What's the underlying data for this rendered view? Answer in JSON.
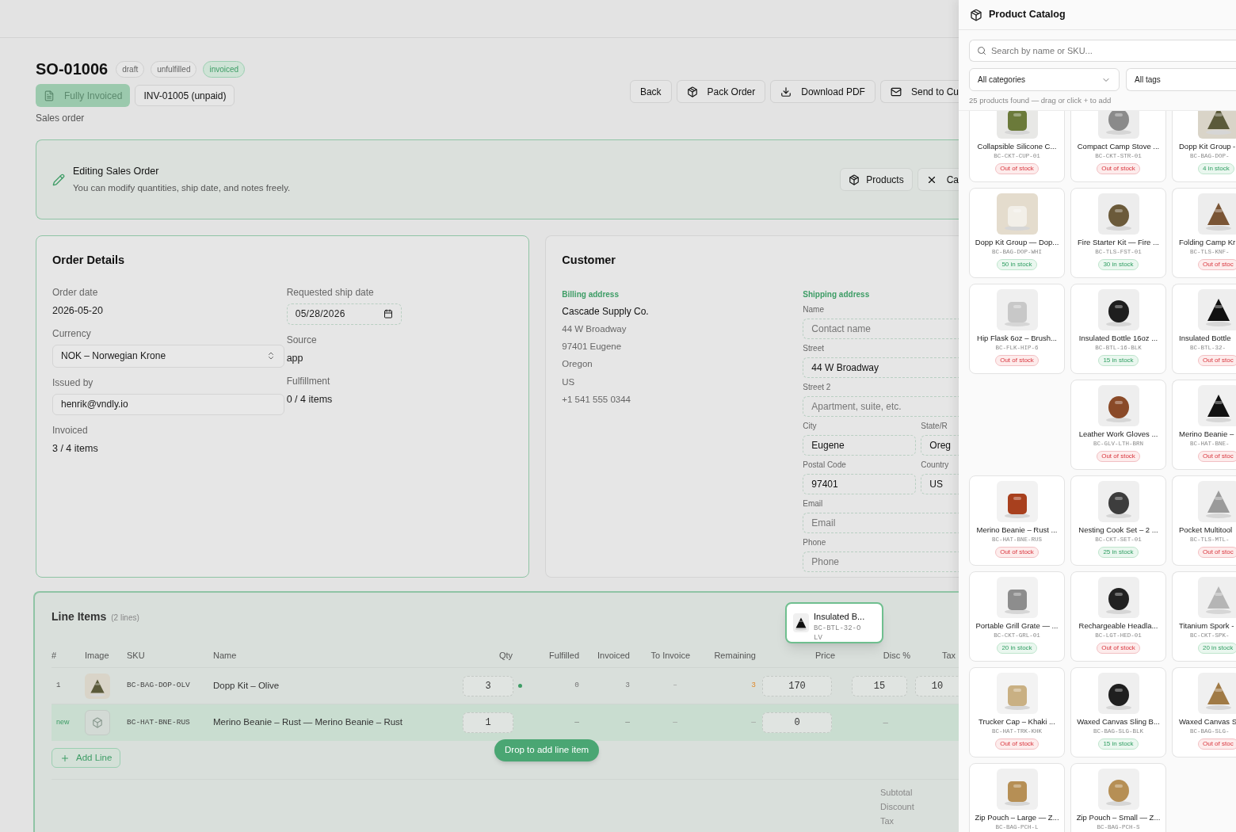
{
  "order": {
    "number": "SO-01006",
    "badges": [
      {
        "label": "draft",
        "selected": false
      },
      {
        "label": "unfulfilled",
        "selected": false
      },
      {
        "label": "invoiced",
        "selected": true
      }
    ],
    "status_button": {
      "label": "Fully Invoiced",
      "disabled": true
    },
    "invoice_button": "INV-01005 (unpaid)",
    "subtitle": "Sales order",
    "actions": [
      "Back",
      "Pack Order",
      "Download PDF",
      "Send to Cu"
    ]
  },
  "banner": {
    "title": "Editing Sales Order",
    "text": "You can modify quantities, ship date, and notes freely.",
    "buttons": [
      "Products",
      "Ca"
    ]
  },
  "order_details": {
    "title": "Order Details",
    "left": [
      {
        "label": "Order date",
        "value": "2026-05-20",
        "kind": "text"
      },
      {
        "label": "Currency",
        "value": "NOK – Norwegian Krone",
        "kind": "select"
      },
      {
        "label": "Issued by",
        "value": "henrik@vndly.io",
        "kind": "input"
      },
      {
        "label": "Invoiced",
        "value": "3 / 4 items",
        "kind": "text"
      }
    ],
    "right": [
      {
        "label": "Requested ship date",
        "value": "05/28/2026",
        "kind": "date"
      },
      {
        "label": "Source",
        "value": "app",
        "kind": "text"
      },
      {
        "label": "Fulfillment",
        "value": "0 / 4 items",
        "kind": "text"
      }
    ]
  },
  "customer": {
    "title": "Customer",
    "billing": {
      "label": "Billing address",
      "name": "Cascade Supply Co.",
      "lines": [
        "44 W Broadway",
        "97401 Eugene",
        "Oregon",
        "US",
        "+1 541 555 0344"
      ]
    },
    "shipping": {
      "label": "Shipping address",
      "rows": [
        [
          {
            "label": "Name",
            "placeholder": "Contact name"
          }
        ],
        [
          {
            "label": "Street",
            "value": "44 W Broadway"
          }
        ],
        [
          {
            "label": "Street 2",
            "placeholder": "Apartment, suite, etc."
          }
        ],
        [
          {
            "label": "City",
            "value": "Eugene"
          },
          {
            "label": "State/R",
            "value": "Oreg"
          }
        ],
        [
          {
            "label": "Postal Code",
            "value": "97401"
          },
          {
            "label": "Country",
            "value": "US"
          }
        ],
        [
          {
            "label": "Email",
            "placeholder": "Email"
          }
        ],
        [
          {
            "label": "Phone",
            "placeholder": "Phone"
          }
        ]
      ]
    }
  },
  "line_items": {
    "title": "Line Items",
    "count": "(2 lines)",
    "columns": [
      "#",
      "Image",
      "SKU",
      "Name",
      "Qty",
      "Fulfilled",
      "Invoiced",
      "To Invoice",
      "Remaining",
      "Price",
      "Disc %",
      "Tax"
    ],
    "rows": [
      {
        "kind": "existing",
        "index": "1",
        "sku": "BC-BAG-DOP-OLV",
        "name": "Dopp Kit – Olive",
        "qty": "3",
        "qty_dot": true,
        "fulfilled": "0",
        "invoiced": "3",
        "to_invoice": "–",
        "remaining": "3",
        "remaining_warning": true,
        "price": "170",
        "disc": "15",
        "tax": "10"
      },
      {
        "kind": "new",
        "index": "new",
        "sku": "BC-HAT-BNE-RUS",
        "name": "Merino Beanie – Rust — Merino Beanie – Rust",
        "qty": "1",
        "qty_dot": false,
        "fulfilled": "—",
        "invoiced": "—",
        "to_invoice": "—",
        "remaining": "—",
        "remaining_warning": false,
        "price": "0",
        "disc": "–"
      }
    ],
    "add_button": "Add Line",
    "drop_hint": "Drop to add line item",
    "drag_ghost": {
      "name": "Insulated B...",
      "sku": "BC-BTL-32-OLV"
    },
    "totals": [
      "Subtotal",
      "Discount",
      "Tax"
    ]
  },
  "catalog": {
    "title": "Product Catalog",
    "search": {
      "placeholder": "Search by name or SKU..."
    },
    "category_filter": "All categories",
    "tag_filter": "All tags",
    "summary": "25 products found — drag or click + to add",
    "products": [
      {
        "kind": "card",
        "name": "Collapsible Silicone C...",
        "sku": "BC-CKT-CUP-01",
        "stock": "Out of stock",
        "in_stock": false
      },
      {
        "kind": "card",
        "name": "Compact Camp Stove ...",
        "sku": "BC-CKT-STR-01",
        "stock": "Out of stock",
        "in_stock": false
      },
      {
        "kind": "card",
        "name": "Dopp Kit Group -",
        "sku": "BC-BAG-DOP-",
        "stock": "4 in stock",
        "in_stock": true
      },
      {
        "kind": "card",
        "name": "Dopp Kit Group — Dop...",
        "sku": "BC-BAG-DOP-WHI",
        "stock": "50 in stock",
        "in_stock": true
      },
      {
        "kind": "card",
        "name": "Fire Starter Kit — Fire ...",
        "sku": "BC-TLS-FST-01",
        "stock": "30 in stock",
        "in_stock": true
      },
      {
        "kind": "card",
        "name": "Folding Camp Kr",
        "sku": "BC-TLS-KNF-",
        "stock": "Out of stoc",
        "in_stock": false
      },
      {
        "kind": "card",
        "name": "Hip Flask 6oz – Brush...",
        "sku": "BC-FLK-HIP-6",
        "stock": "Out of stock",
        "in_stock": false
      },
      {
        "kind": "card",
        "name": "Insulated Bottle 16oz ...",
        "sku": "BC-BTL-16-BLK",
        "stock": "15 in stock",
        "in_stock": true
      },
      {
        "kind": "card",
        "name": "Insulated Bottle",
        "sku": "BC-BTL-32-",
        "stock": "Out of stoc",
        "in_stock": false
      },
      {
        "kind": "empty"
      },
      {
        "kind": "card",
        "name": "Leather Work Gloves ...",
        "sku": "BC-GLV-LTH-BRN",
        "stock": "Out of stock",
        "in_stock": false
      },
      {
        "kind": "card",
        "name": "Merino Beanie –",
        "sku": "BC-HAT-BNE-",
        "stock": "Out of stoc",
        "in_stock": false
      },
      {
        "kind": "card",
        "name": "Merino Beanie – Rust ...",
        "sku": "BC-HAT-BNE-RUS",
        "stock": "Out of stock",
        "in_stock": false
      },
      {
        "kind": "card",
        "name": "Nesting Cook Set – 2 ...",
        "sku": "BC-CKT-SET-01",
        "stock": "25 in stock",
        "in_stock": true
      },
      {
        "kind": "card",
        "name": "Pocket Multitool",
        "sku": "BC-TLS-MTL-",
        "stock": "Out of stoc",
        "in_stock": false
      },
      {
        "kind": "card",
        "name": "Portable Grill Grate — ...",
        "sku": "BC-CKT-GRL-01",
        "stock": "20 in stock",
        "in_stock": true
      },
      {
        "kind": "card",
        "name": "Rechargeable Headla...",
        "sku": "BC-LGT-HED-01",
        "stock": "Out of stock",
        "in_stock": false
      },
      {
        "kind": "card",
        "name": "Titanium Spork -",
        "sku": "BC-CKT-SPK-",
        "stock": "20 in stock",
        "in_stock": true
      },
      {
        "kind": "card",
        "name": "Trucker Cap – Khaki ...",
        "sku": "BC-HAT-TRK-KHK",
        "stock": "Out of stock",
        "in_stock": false
      },
      {
        "kind": "card",
        "name": "Waxed Canvas Sling B...",
        "sku": "BC-BAG-SLG-BLK",
        "stock": "15 in stock",
        "in_stock": true
      },
      {
        "kind": "card",
        "name": "Waxed Canvas S",
        "sku": "BC-BAG-SLG-",
        "stock": "Out of stoc",
        "in_stock": false
      },
      {
        "kind": "card",
        "name": "Zip Pouch – Large — Z...",
        "sku": "BC-BAG-PCH-L"
      },
      {
        "kind": "card",
        "name": "Zip Pouch – Small — Z...",
        "sku": "BC-BAG-PCH-S"
      }
    ]
  }
}
